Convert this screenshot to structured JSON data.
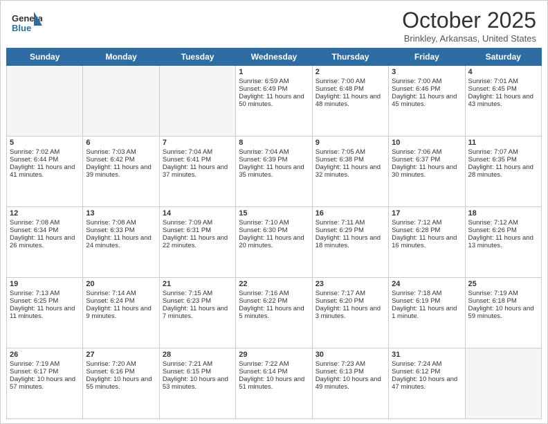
{
  "header": {
    "logo_general": "General",
    "logo_blue": "Blue",
    "month_title": "October 2025",
    "location": "Brinkley, Arkansas, United States"
  },
  "days_of_week": [
    "Sunday",
    "Monday",
    "Tuesday",
    "Wednesday",
    "Thursday",
    "Friday",
    "Saturday"
  ],
  "weeks": [
    [
      {
        "day": "",
        "info": ""
      },
      {
        "day": "",
        "info": ""
      },
      {
        "day": "",
        "info": ""
      },
      {
        "day": "1",
        "info": "Sunrise: 6:59 AM\nSunset: 6:49 PM\nDaylight: 11 hours and 50 minutes."
      },
      {
        "day": "2",
        "info": "Sunrise: 7:00 AM\nSunset: 6:48 PM\nDaylight: 11 hours and 48 minutes."
      },
      {
        "day": "3",
        "info": "Sunrise: 7:00 AM\nSunset: 6:46 PM\nDaylight: 11 hours and 45 minutes."
      },
      {
        "day": "4",
        "info": "Sunrise: 7:01 AM\nSunset: 6:45 PM\nDaylight: 11 hours and 43 minutes."
      }
    ],
    [
      {
        "day": "5",
        "info": "Sunrise: 7:02 AM\nSunset: 6:44 PM\nDaylight: 11 hours and 41 minutes."
      },
      {
        "day": "6",
        "info": "Sunrise: 7:03 AM\nSunset: 6:42 PM\nDaylight: 11 hours and 39 minutes."
      },
      {
        "day": "7",
        "info": "Sunrise: 7:04 AM\nSunset: 6:41 PM\nDaylight: 11 hours and 37 minutes."
      },
      {
        "day": "8",
        "info": "Sunrise: 7:04 AM\nSunset: 6:39 PM\nDaylight: 11 hours and 35 minutes."
      },
      {
        "day": "9",
        "info": "Sunrise: 7:05 AM\nSunset: 6:38 PM\nDaylight: 11 hours and 32 minutes."
      },
      {
        "day": "10",
        "info": "Sunrise: 7:06 AM\nSunset: 6:37 PM\nDaylight: 11 hours and 30 minutes."
      },
      {
        "day": "11",
        "info": "Sunrise: 7:07 AM\nSunset: 6:35 PM\nDaylight: 11 hours and 28 minutes."
      }
    ],
    [
      {
        "day": "12",
        "info": "Sunrise: 7:08 AM\nSunset: 6:34 PM\nDaylight: 11 hours and 26 minutes."
      },
      {
        "day": "13",
        "info": "Sunrise: 7:08 AM\nSunset: 6:33 PM\nDaylight: 11 hours and 24 minutes."
      },
      {
        "day": "14",
        "info": "Sunrise: 7:09 AM\nSunset: 6:31 PM\nDaylight: 11 hours and 22 minutes."
      },
      {
        "day": "15",
        "info": "Sunrise: 7:10 AM\nSunset: 6:30 PM\nDaylight: 11 hours and 20 minutes."
      },
      {
        "day": "16",
        "info": "Sunrise: 7:11 AM\nSunset: 6:29 PM\nDaylight: 11 hours and 18 minutes."
      },
      {
        "day": "17",
        "info": "Sunrise: 7:12 AM\nSunset: 6:28 PM\nDaylight: 11 hours and 16 minutes."
      },
      {
        "day": "18",
        "info": "Sunrise: 7:12 AM\nSunset: 6:26 PM\nDaylight: 11 hours and 13 minutes."
      }
    ],
    [
      {
        "day": "19",
        "info": "Sunrise: 7:13 AM\nSunset: 6:25 PM\nDaylight: 11 hours and 11 minutes."
      },
      {
        "day": "20",
        "info": "Sunrise: 7:14 AM\nSunset: 6:24 PM\nDaylight: 11 hours and 9 minutes."
      },
      {
        "day": "21",
        "info": "Sunrise: 7:15 AM\nSunset: 6:23 PM\nDaylight: 11 hours and 7 minutes."
      },
      {
        "day": "22",
        "info": "Sunrise: 7:16 AM\nSunset: 6:22 PM\nDaylight: 11 hours and 5 minutes."
      },
      {
        "day": "23",
        "info": "Sunrise: 7:17 AM\nSunset: 6:20 PM\nDaylight: 11 hours and 3 minutes."
      },
      {
        "day": "24",
        "info": "Sunrise: 7:18 AM\nSunset: 6:19 PM\nDaylight: 11 hours and 1 minute."
      },
      {
        "day": "25",
        "info": "Sunrise: 7:19 AM\nSunset: 6:18 PM\nDaylight: 10 hours and 59 minutes."
      }
    ],
    [
      {
        "day": "26",
        "info": "Sunrise: 7:19 AM\nSunset: 6:17 PM\nDaylight: 10 hours and 57 minutes."
      },
      {
        "day": "27",
        "info": "Sunrise: 7:20 AM\nSunset: 6:16 PM\nDaylight: 10 hours and 55 minutes."
      },
      {
        "day": "28",
        "info": "Sunrise: 7:21 AM\nSunset: 6:15 PM\nDaylight: 10 hours and 53 minutes."
      },
      {
        "day": "29",
        "info": "Sunrise: 7:22 AM\nSunset: 6:14 PM\nDaylight: 10 hours and 51 minutes."
      },
      {
        "day": "30",
        "info": "Sunrise: 7:23 AM\nSunset: 6:13 PM\nDaylight: 10 hours and 49 minutes."
      },
      {
        "day": "31",
        "info": "Sunrise: 7:24 AM\nSunset: 6:12 PM\nDaylight: 10 hours and 47 minutes."
      },
      {
        "day": "",
        "info": ""
      }
    ]
  ]
}
